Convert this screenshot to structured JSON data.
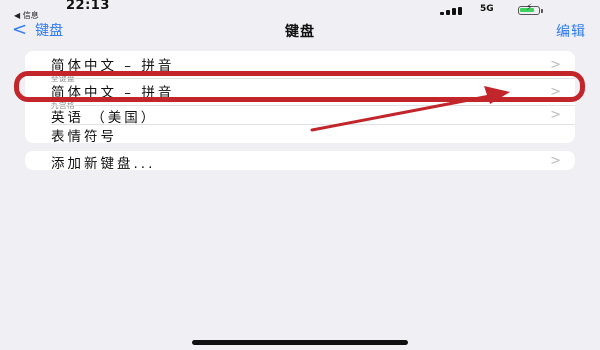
{
  "status_bar": {
    "time": "22:13",
    "back_app": "◀ 信息",
    "network": "5G",
    "battery_color": "#3cd35d"
  },
  "nav": {
    "back_label": "键盘",
    "title": "键盘",
    "edit_label": "编辑",
    "accent_color": "#2f7bf5"
  },
  "keyboards": [
    {
      "label": "简体中文 – 拼音",
      "sub": "全键盘"
    },
    {
      "label": "简体中文 – 拼音",
      "sub": "九宫格"
    },
    {
      "label": "英语 （美国）"
    },
    {
      "label": "表情符号"
    }
  ],
  "add_keyboard": {
    "label": "添加新键盘..."
  },
  "annotation": {
    "color": "#c2262b",
    "highlighted_item": "简体中文 – 拼音 (九宫格)"
  }
}
